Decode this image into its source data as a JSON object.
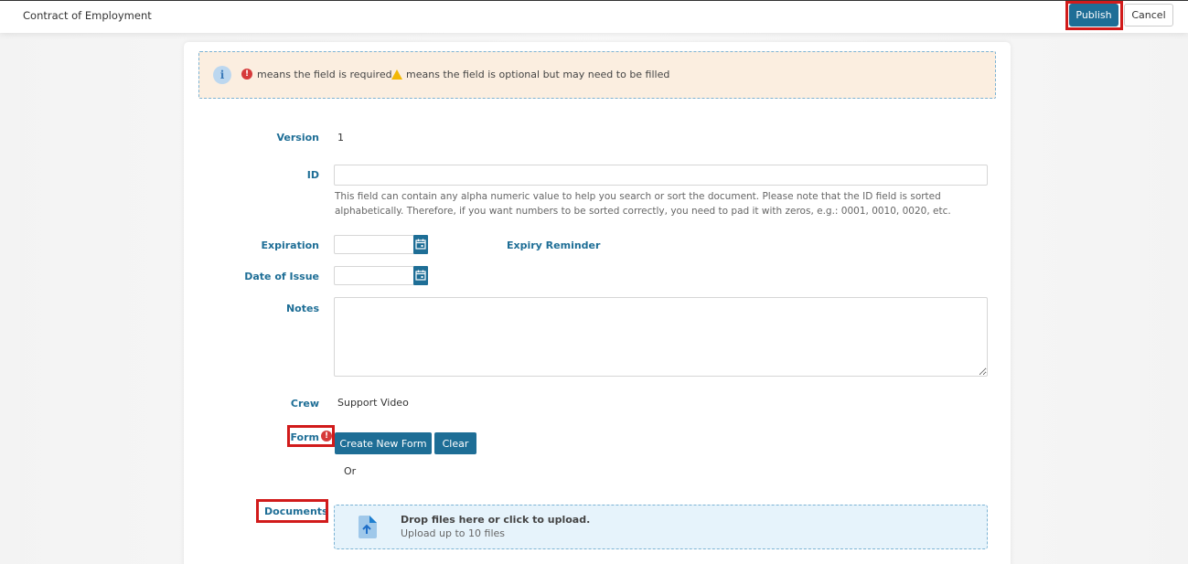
{
  "header": {
    "title": "Contract of Employment",
    "publish_label": "Publish",
    "cancel_label": "Cancel"
  },
  "banner": {
    "required_text": "means the field is required",
    "optional_text": "means the field is optional but may need to be filled"
  },
  "form": {
    "version_label": "Version",
    "version_value": "1",
    "id_label": "ID",
    "id_value": "",
    "id_help": "This field can contain any alpha numeric value to help you search or sort the document. Please note that the ID field is sorted alphabetically. Therefore, if you want numbers to be sorted correctly, you need to pad it with zeros, e.g.: 0001, 0010, 0020, etc.",
    "expiration_label": "Expiration",
    "expiration_value": "",
    "expiry_reminder_label": "Expiry Reminder",
    "date_of_issue_label": "Date of Issue",
    "date_of_issue_value": "",
    "notes_label": "Notes",
    "notes_value": "",
    "crew_label": "Crew",
    "crew_value": "Support Video",
    "form_label": "Form",
    "create_new_form_label": "Create New Form",
    "clear_label": "Clear",
    "or_text": "Or",
    "documents_label": "Documents",
    "upload_title": "Drop files here or click to upload.",
    "upload_subtitle": "Upload up to 10 files"
  },
  "colors": {
    "accent": "#1e6e96",
    "highlight": "#d11b1b",
    "required": "#d63a3a",
    "warning": "#f2b705",
    "banner_bg": "#fbeee0"
  }
}
